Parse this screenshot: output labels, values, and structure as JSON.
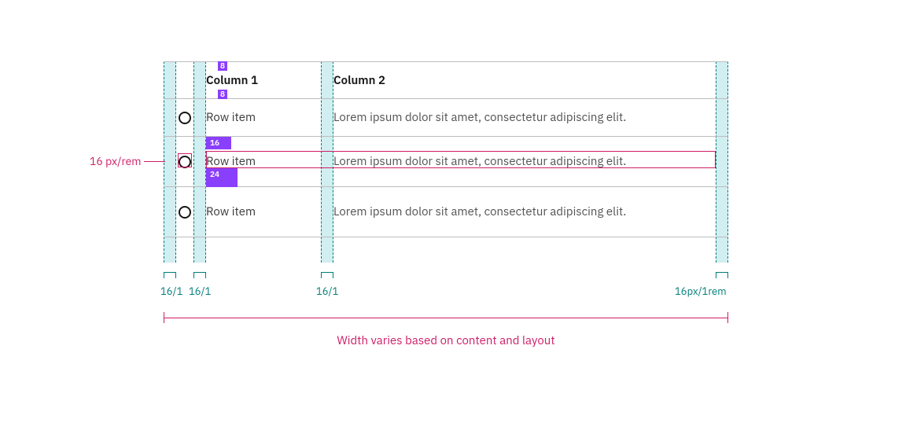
{
  "header": {
    "col1": "Column 1",
    "col2": "Column 2"
  },
  "rows": [
    {
      "col1": "Row item",
      "col2": "Lorem ipsum dolor sit amet, consectetur adipiscing elit."
    },
    {
      "col1": "Row item",
      "col2": "Lorem ipsum dolor sit amet, consectetur adipiscing elit."
    },
    {
      "col1": "Row item",
      "col2": "Lorem ipsum dolor sit amet, consectetur adipiscing elit."
    }
  ],
  "spacing_tags": {
    "top": "8",
    "bottom": "8",
    "row2_top": "16",
    "row2_bottom": "24"
  },
  "annotations": {
    "radio_size": "16 px/rem",
    "dims": {
      "d1": "16/1",
      "d2": "16/1",
      "d3": "16/1",
      "d4": "16px/1rem"
    },
    "width_note": "Width varies based on content and layout"
  },
  "colors": {
    "teal": "#007d79",
    "purple": "#8a3ffc",
    "magenta": "#cf1d67"
  }
}
